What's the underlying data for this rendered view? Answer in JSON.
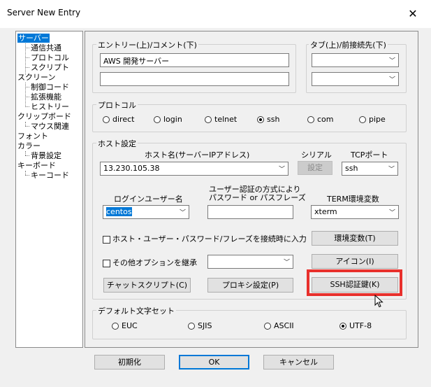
{
  "window": {
    "title": "Server New Entry",
    "close_glyph": "✕"
  },
  "tree": {
    "items": [
      {
        "label": "サーバー",
        "level": 0,
        "selected": true
      },
      {
        "label": "通信共通",
        "level": 1
      },
      {
        "label": "プロトコル",
        "level": 1
      },
      {
        "label": "スクリプト",
        "level": 1
      },
      {
        "label": "スクリーン",
        "level": 0
      },
      {
        "label": "制御コード",
        "level": 1
      },
      {
        "label": "拡張機能",
        "level": 1
      },
      {
        "label": "ヒストリー",
        "level": 1
      },
      {
        "label": "クリップボード",
        "level": 0
      },
      {
        "label": "マウス関連",
        "level": 1
      },
      {
        "label": "フォント",
        "level": 0
      },
      {
        "label": "カラー",
        "level": 0
      },
      {
        "label": "背景設定",
        "level": 1
      },
      {
        "label": "キーボード",
        "level": 0
      },
      {
        "label": "キーコード",
        "level": 1
      }
    ]
  },
  "entry": {
    "group_label": "エントリー(上)/コメント(下)",
    "entry_value": "AWS 開発サーバー",
    "comment_value": ""
  },
  "tab": {
    "group_label": "タブ(上)/前接続先(下)",
    "tab_value": "",
    "prev_value": ""
  },
  "protocol": {
    "group_label": "プロトコル",
    "options": [
      "direct",
      "login",
      "telnet",
      "ssh",
      "com",
      "pipe"
    ],
    "selected": "ssh"
  },
  "host": {
    "group_label": "ホスト設定",
    "hostname_label": "ホスト名(サーバーIPアドレス)",
    "hostname_value": "13.230.105.38",
    "serial_label": "シリアル",
    "serial_button": "設定",
    "tcp_label": "TCPポート",
    "tcp_value": "ssh",
    "login_user_label": "ログインユーザー名",
    "login_user_value": "centos",
    "auth_label_line1": "ユーザー認証の方式により",
    "auth_label_line2": "パスワード or パスフレーズ",
    "auth_value": "",
    "term_label": "TERM環境変数",
    "term_value": "xterm",
    "input_on_connect_label": "ホスト・ユーザー・パスワード/フレーズを接続時に入力",
    "input_on_connect_checked": false,
    "env_button": "環境変数(T)",
    "inherit_label": "その他オプションを継承",
    "inherit_checked": false,
    "inherit_value": "",
    "icon_button": "アイコン(I)",
    "chat_button": "チャットスクリプト(C)",
    "proxy_button": "プロキシ設定(P)",
    "ssh_key_button": "SSH認証鍵(K)"
  },
  "charset": {
    "group_label": "デフォルト文字セット",
    "options": [
      "EUC",
      "SJIS",
      "ASCII",
      "UTF-8"
    ],
    "selected": "UTF-8"
  },
  "footer": {
    "init_button": "初期化",
    "ok_button": "OK",
    "cancel_button": "キャンセル"
  },
  "colors": {
    "highlight": "#e8302c",
    "selection": "#0078d7"
  }
}
